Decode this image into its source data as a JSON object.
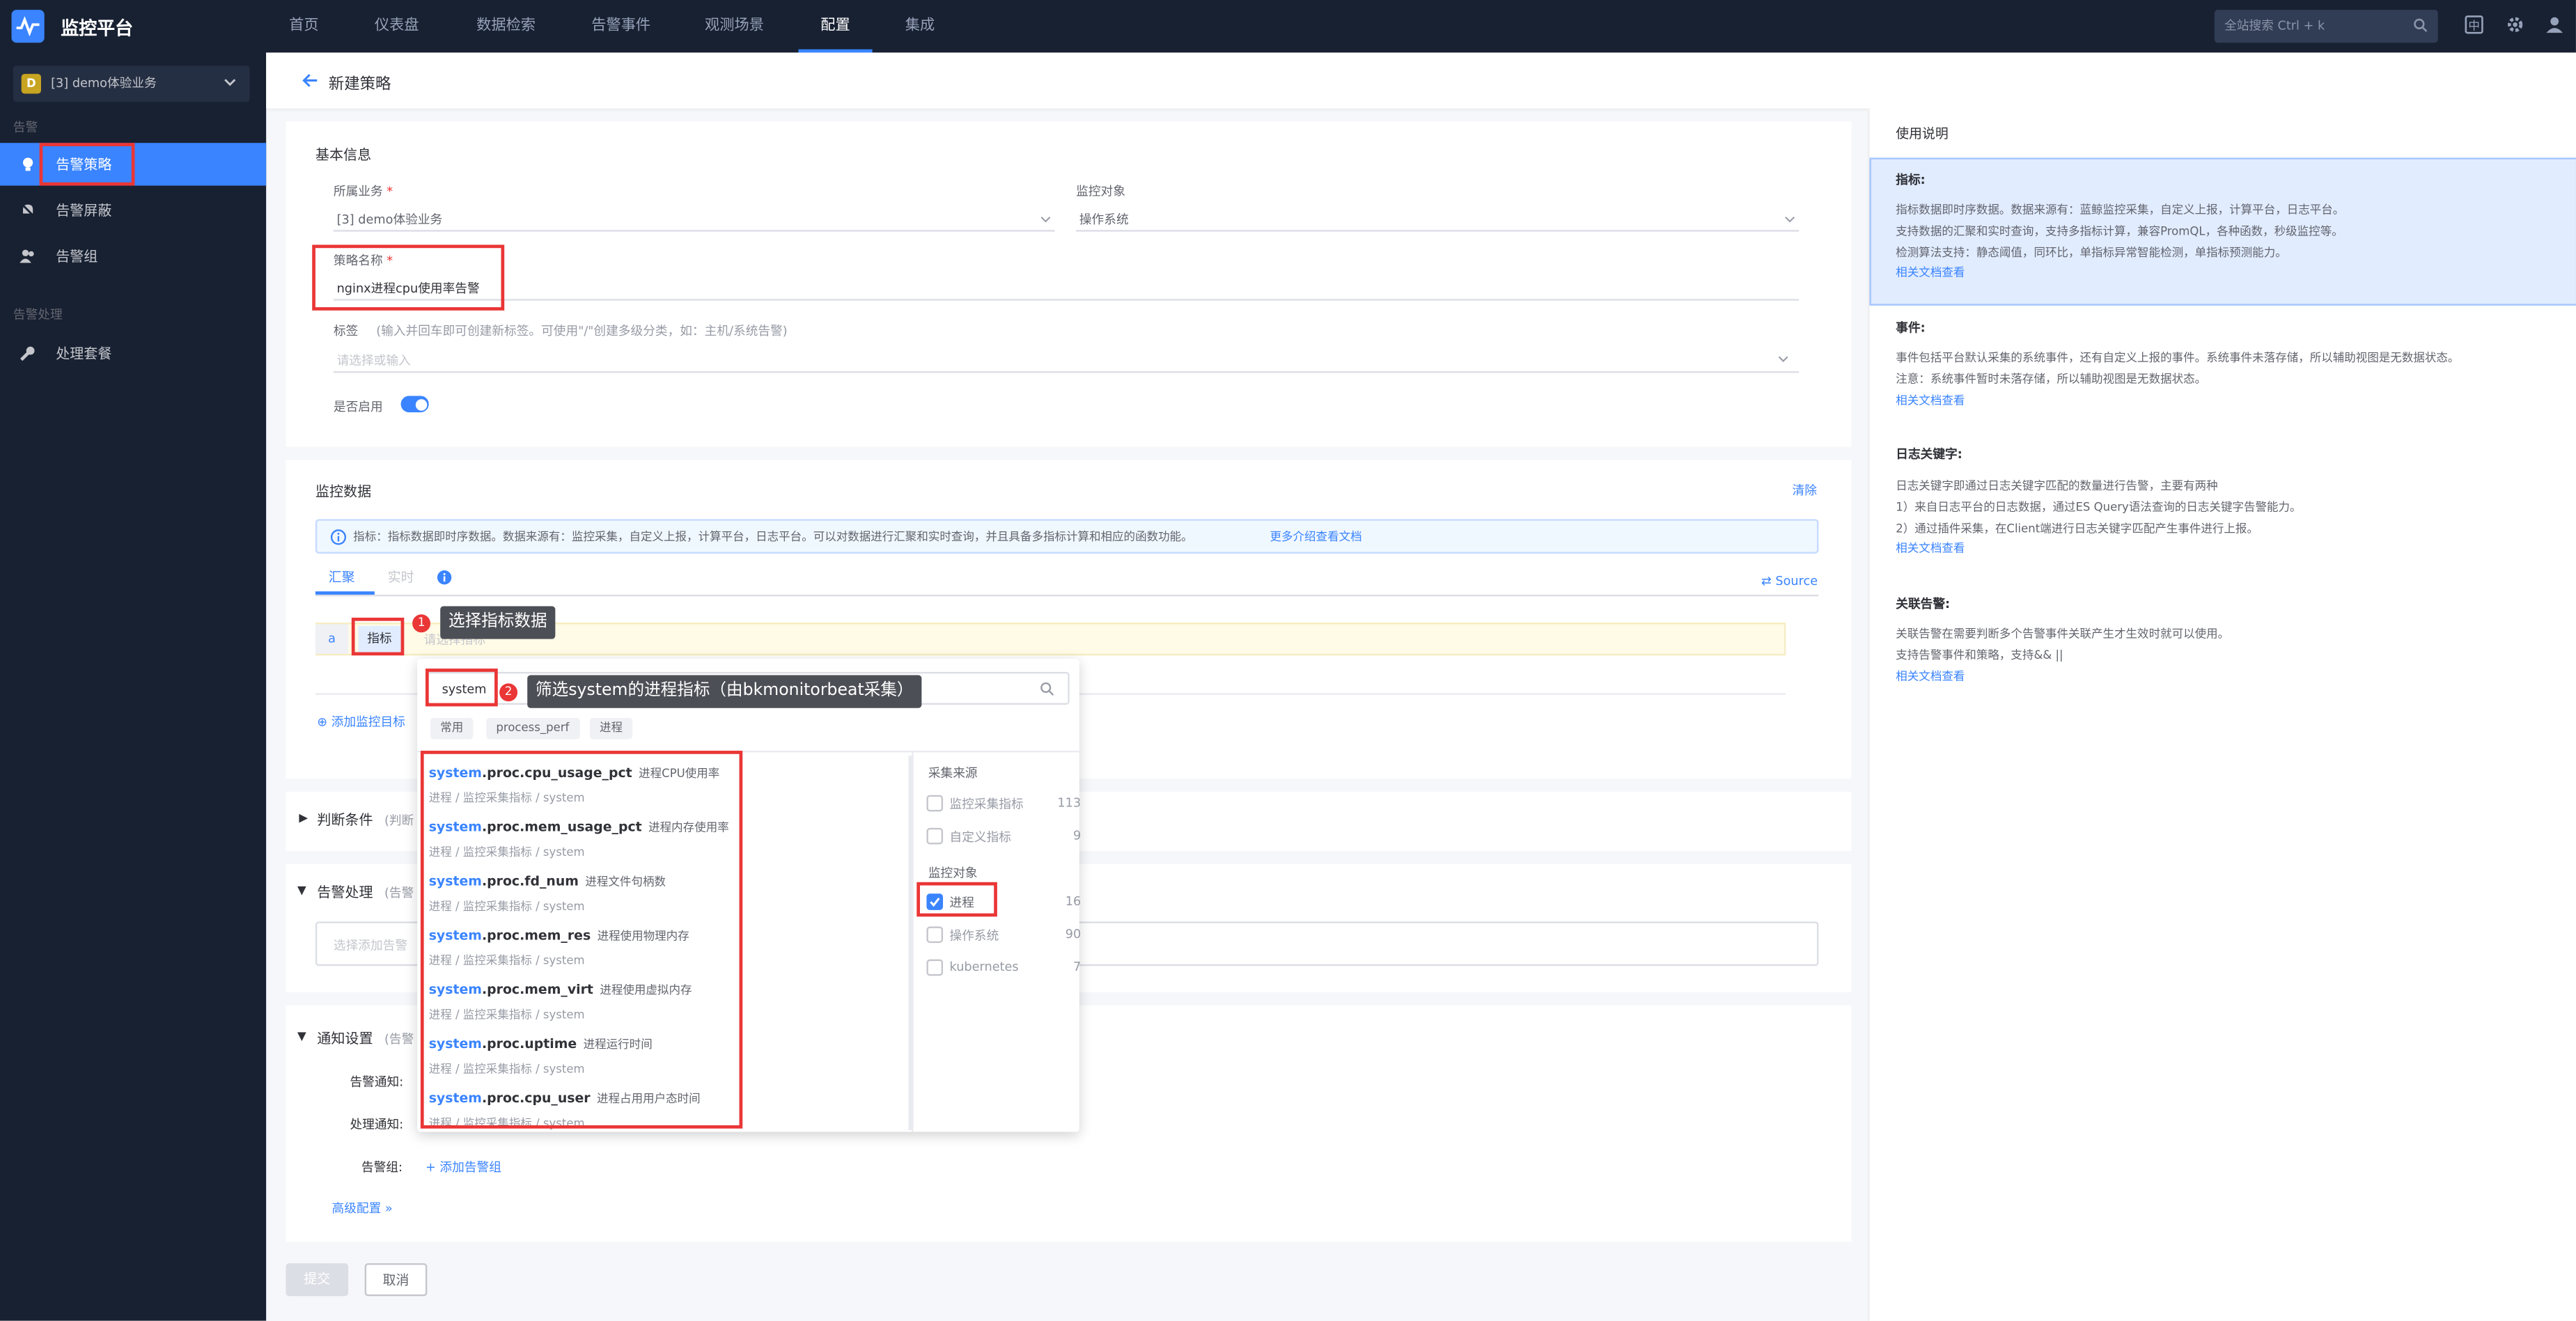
{
  "app": {
    "title": "监控平台"
  },
  "nav": {
    "items": [
      "首页",
      "仪表盘",
      "数据检索",
      "告警事件",
      "观测场景",
      "配置",
      "集成"
    ],
    "active": "配置"
  },
  "search": {
    "placeholder": "全站搜索 Ctrl + k"
  },
  "sidebar": {
    "business_badge": "D",
    "business": "[3] demo体验业务",
    "group1": "告警",
    "items": [
      "告警策略",
      "告警屏蔽",
      "告警组"
    ],
    "group2": "告警处理",
    "items2": [
      "处理套餐"
    ]
  },
  "page": {
    "title": "新建策略"
  },
  "basic": {
    "title": "基本信息",
    "biz_label": "所属业务",
    "biz_value": "[3] demo体验业务",
    "target_label": "监控对象",
    "target_value": "操作系统",
    "name_label": "策略名称",
    "name_value": "nginx进程cpu使用率告警",
    "tag_label": "标签",
    "tag_hint": "(输入并回车即可创建新标签。可使用\"/\"创建多级分类，如：主机/系统告警)",
    "tag_placeholder": "请选择或输入",
    "enable_label": "是否启用",
    "required_mark": "*"
  },
  "monitor": {
    "title": "监控数据",
    "clear": "清除",
    "info": "指标：指标数据即时序数据。数据来源有：监控采集，自定义上报，计算平台，日志平台。可以对数据进行汇聚和实时查询，并且具备多指标计算和相应的函数功能。",
    "info_link": "更多介绍查看文档",
    "tab_agg": "汇聚",
    "tab_rt": "实时",
    "source": "Source",
    "row_letter": "a",
    "metric_btn": "指标",
    "metric_placeholder": "请选择指标",
    "add_target": "添加监控目标"
  },
  "dropdown": {
    "search_value": "system",
    "quick_tags": [
      "常用",
      "process_perf",
      "进程"
    ],
    "metrics": [
      {
        "hl": "system",
        "name": ".proc.cpu_usage_pct",
        "desc": "进程CPU使用率",
        "path": "进程 / 监控采集指标 / system"
      },
      {
        "hl": "system",
        "name": ".proc.mem_usage_pct",
        "desc": "进程内存使用率",
        "path": "进程 / 监控采集指标 / system"
      },
      {
        "hl": "system",
        "name": ".proc.fd_num",
        "desc": "进程文件句柄数",
        "path": "进程 / 监控采集指标 / system"
      },
      {
        "hl": "system",
        "name": ".proc.mem_res",
        "desc": "进程使用物理内存",
        "path": "进程 / 监控采集指标 / system"
      },
      {
        "hl": "system",
        "name": ".proc.mem_virt",
        "desc": "进程使用虚拟内存",
        "path": "进程 / 监控采集指标 / system"
      },
      {
        "hl": "system",
        "name": ".proc.uptime",
        "desc": "进程运行时间",
        "path": "进程 / 监控采集指标 / system"
      },
      {
        "hl": "system",
        "name": ".proc.cpu_user",
        "desc": "进程占用用户态时间",
        "path": "进程 / 监控采集指标 / system"
      }
    ],
    "filter_source_title": "采集来源",
    "filter_source": [
      {
        "label": "监控采集指标",
        "count": "113"
      },
      {
        "label": "自定义指标",
        "count": "9"
      }
    ],
    "filter_target_title": "监控对象",
    "filter_target": [
      {
        "label": "进程",
        "count": "16"
      },
      {
        "label": "操作系统",
        "count": "90"
      },
      {
        "label": "kubernetes",
        "count": "7"
      }
    ]
  },
  "annotations": {
    "step1": "1",
    "step1_text": "选择指标数据",
    "step2": "2",
    "step2_text": "筛选system的进程指标（由bkmonitorbeat采集）"
  },
  "condition": {
    "title": "判断条件",
    "hint": "(判断"
  },
  "handling": {
    "title": "告警处理",
    "hint": "(告警",
    "placeholder": "选择添加告警"
  },
  "notify": {
    "title": "通知设置",
    "hint": "(告警",
    "alarm_notify": "告警通知:",
    "handle_notify": "处理通知:",
    "alarm_group": "告警组:",
    "add_group": "+ 添加告警组",
    "advanced": "高级配置"
  },
  "footer": {
    "submit": "提交",
    "cancel": "取消"
  },
  "help": {
    "title": "使用说明",
    "sections": [
      {
        "h": "指标:",
        "lines": [
          "指标数据即时序数据。数据来源有：蓝鲸监控采集，自定义上报，计算平台，日志平台。",
          "支持数据的汇聚和实时查询，支持多指标计算，兼容PromQL，各种函数，秒级监控等。",
          "检测算法支持：静态阈值，同环比，单指标异常智能检测，单指标预测能力。"
        ],
        "link": "相关文档查看"
      },
      {
        "h": "事件:",
        "lines": [
          "事件包括平台默认采集的系统事件，还有自定义上报的事件。系统事件未落存储，所以辅助视图是无数据状态。",
          "注意：系统事件暂时未落存储，所以辅助视图是无数据状态。"
        ],
        "link": "相关文档查看"
      },
      {
        "h": "日志关键字:",
        "lines": [
          "日志关键字即通过日志关键字匹配的数量进行告警，主要有两种",
          "1）来自日志平台的日志数据，通过ES Query语法查询的日志关键字告警能力。",
          "2）通过插件采集，在Client端进行日志关键字匹配产生事件进行上报。"
        ],
        "link": "相关文档查看"
      },
      {
        "h": "关联告警:",
        "lines": [
          "关联告警在需要判断多个告警事件关联产生才生效时就可以使用。",
          "支持告警事件和策略，支持&& ||"
        ],
        "link": "相关文档查看"
      }
    ]
  },
  "colors": {
    "primary": "#3a84ff",
    "nav_bg": "#182132",
    "annotation": "#ea3636"
  }
}
